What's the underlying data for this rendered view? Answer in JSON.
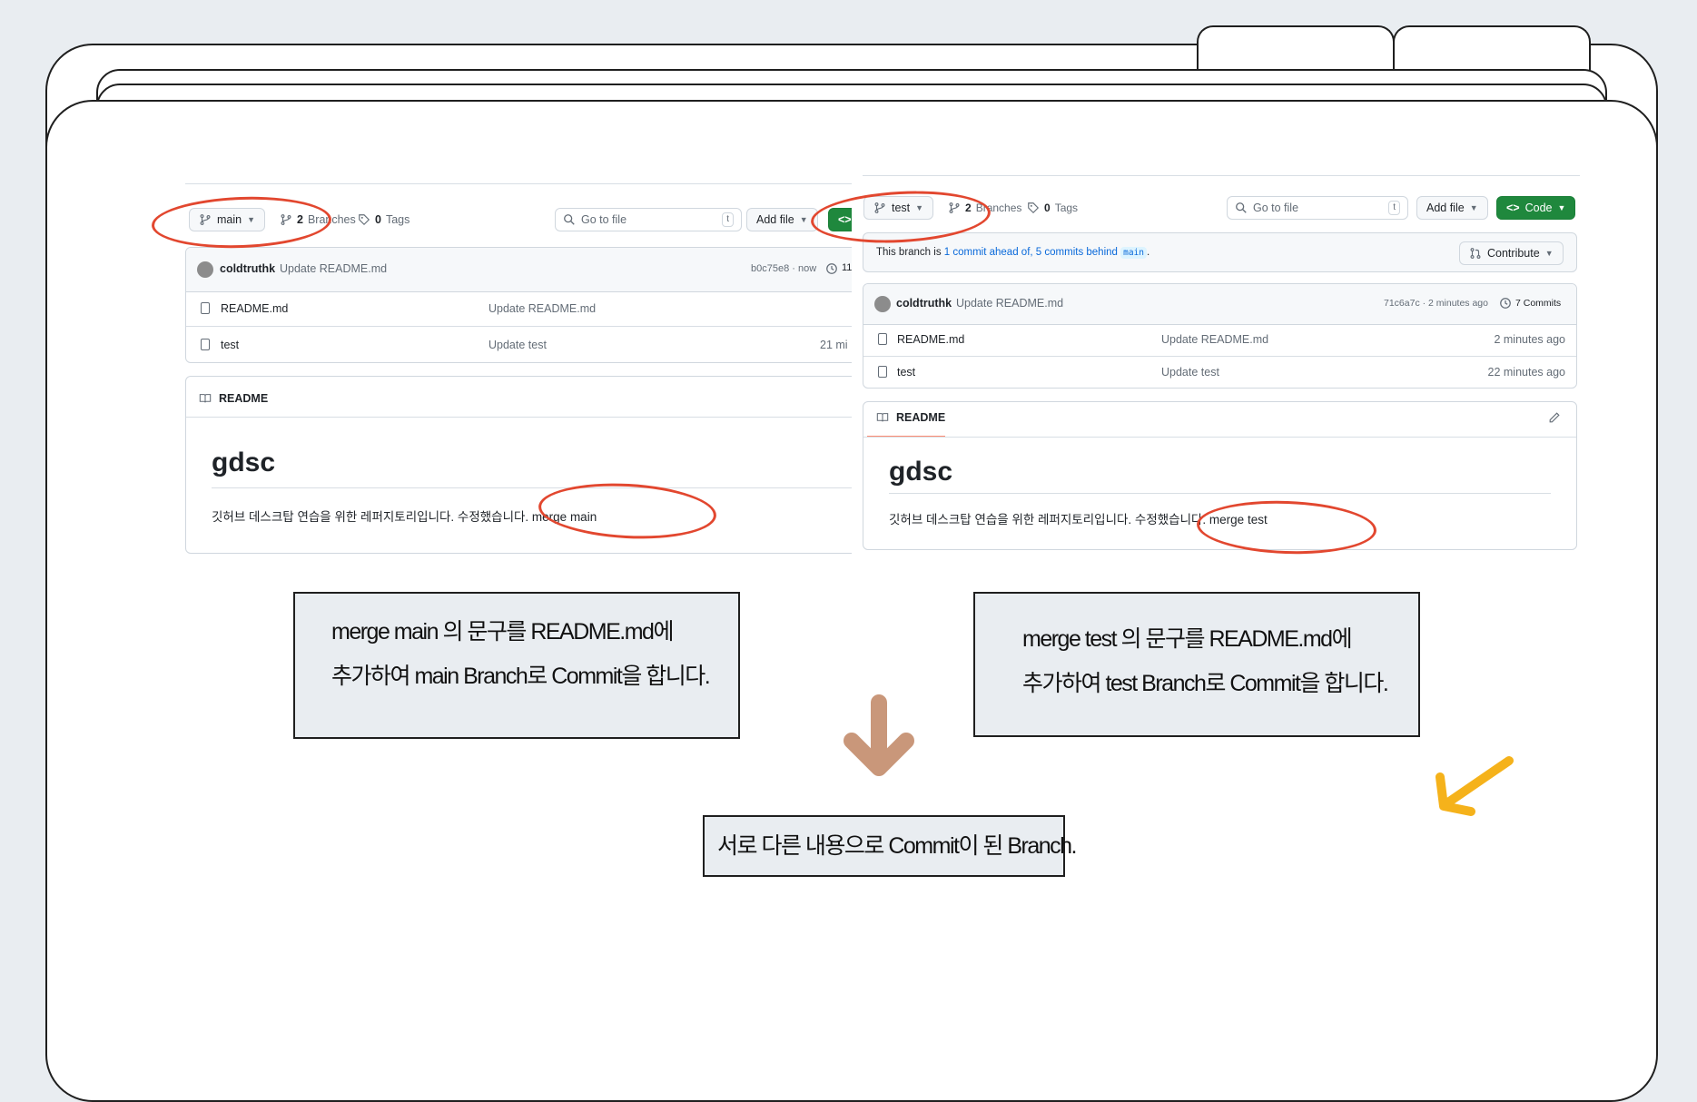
{
  "left_repo": {
    "branch": "main",
    "branches_count": "2",
    "branches_label": "Branches",
    "tags_count": "0",
    "tags_label": "Tags",
    "search_placeholder": "Go to file",
    "search_key": "t",
    "add_file": "Add file",
    "commit": {
      "author": "coldtruthk",
      "message": "Update README.md",
      "hash_time": "b0c75e8 · now",
      "commits_count": "11"
    },
    "files": [
      {
        "name": "README.md",
        "message": "Update README.md",
        "time": ""
      },
      {
        "name": "test",
        "message": "Update test",
        "time": "21 mi"
      }
    ],
    "readme_tab": "README",
    "readme_title": "gdsc",
    "readme_text": "깃허브 데스크탑 연습을 위한 레퍼지토리입니다. 수정했습니다. merge main"
  },
  "right_repo": {
    "branch": "test",
    "branches_count": "2",
    "branches_label": "Branches",
    "tags_count": "0",
    "tags_label": "Tags",
    "search_placeholder": "Go to file",
    "search_key": "t",
    "add_file": "Add file",
    "code_button": "Code",
    "ahead_prefix": "This branch is ",
    "ahead_link": "1 commit ahead of,",
    "behind_link": "5 commits behind",
    "behind_branch": "main",
    "ahead_suffix": ".",
    "contribute": "Contribute",
    "commit": {
      "author": "coldtruthk",
      "message": "Update README.md",
      "hash_time": "71c6a7c · 2 minutes ago",
      "commits_count": "7 Commits"
    },
    "files": [
      {
        "name": "README.md",
        "message": "Update README.md",
        "time": "2 minutes ago"
      },
      {
        "name": "test",
        "message": "Update test",
        "time": "22 minutes ago"
      }
    ],
    "readme_tab": "README",
    "readme_title": "gdsc",
    "readme_text": "깃허브 데스크탑 연습을 위한 레퍼지토리입니다. 수정했습니다. merge test"
  },
  "notes": {
    "left_line1": "merge main  의 문구를 README.md에",
    "left_line2": "추가하여 main Branch로 Commit을 합니다.",
    "right_line1": "merge test  의 문구를 README.md에",
    "right_line2": "추가하여 test Branch로 Commit을 합니다.",
    "bottom": "서로 다른 내용으로 Commit이 된 Branch."
  },
  "colors": {
    "highlight": "#e2472f",
    "arrow_down": "#c9977a",
    "arrow_diag": "#f5b21b",
    "green": "#1f883d"
  },
  "icons": [
    "branch-icon",
    "tag-icon",
    "search-icon",
    "history-icon",
    "file-icon",
    "book-icon",
    "pencil-icon",
    "code-icon",
    "caret-down-icon",
    "pull-request-icon",
    "avatar"
  ]
}
